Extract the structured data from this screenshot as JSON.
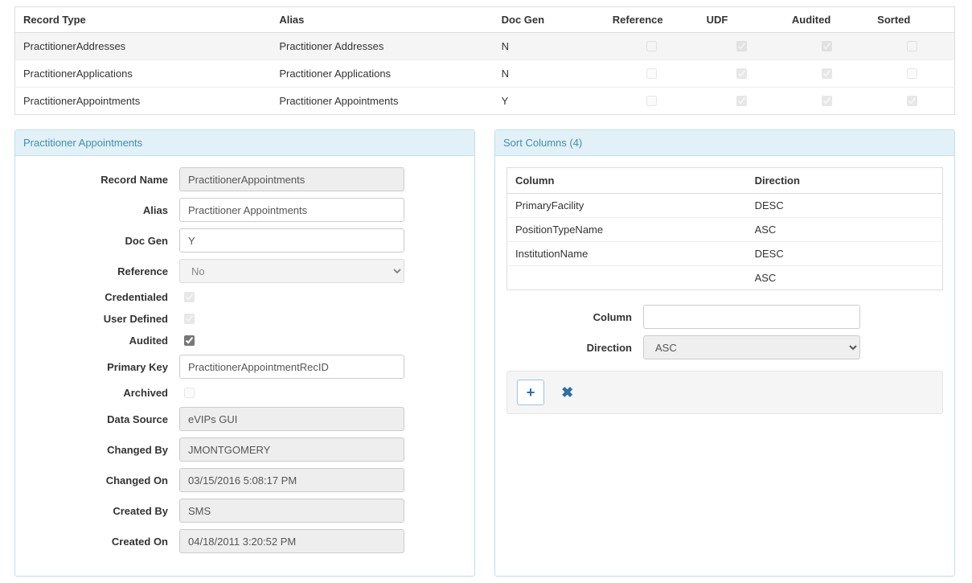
{
  "grid": {
    "headers": {
      "record_type": "Record Type",
      "alias": "Alias",
      "doc_gen": "Doc Gen",
      "reference": "Reference",
      "udf": "UDF",
      "audited": "Audited",
      "sorted": "Sorted"
    },
    "rows": [
      {
        "record_type": "PractitionerAddresses",
        "alias": "Practitioner Addresses",
        "doc_gen": "N",
        "reference": false,
        "udf": true,
        "audited": true,
        "sorted": false,
        "selected": true
      },
      {
        "record_type": "PractitionerApplications",
        "alias": "Practitioner Applications",
        "doc_gen": "N",
        "reference": false,
        "udf": true,
        "audited": true,
        "sorted": false,
        "selected": false
      },
      {
        "record_type": "PractitionerAppointments",
        "alias": "Practitioner Appointments",
        "doc_gen": "Y",
        "reference": false,
        "udf": true,
        "audited": true,
        "sorted": true,
        "selected": false
      }
    ]
  },
  "detail": {
    "title": "Practitioner Appointments",
    "labels": {
      "record_name": "Record Name",
      "alias": "Alias",
      "doc_gen": "Doc Gen",
      "reference": "Reference",
      "credentialed": "Credentialed",
      "user_defined": "User Defined",
      "audited": "Audited",
      "primary_key": "Primary Key",
      "archived": "Archived",
      "data_source": "Data Source",
      "changed_by": "Changed By",
      "changed_on": "Changed On",
      "created_by": "Created By",
      "created_on": "Created On"
    },
    "values": {
      "record_name": "PractitionerAppointments",
      "alias": "Practitioner Appointments",
      "doc_gen": "Y",
      "reference": "No",
      "credentialed": true,
      "user_defined": true,
      "audited": true,
      "primary_key": "PractitionerAppointmentRecID",
      "archived": false,
      "data_source": "eVIPs GUI",
      "changed_by": "JMONTGOMERY",
      "changed_on": "03/15/2016 5:08:17 PM",
      "created_by": "SMS",
      "created_on": "04/18/2011 3:20:52 PM"
    }
  },
  "sort": {
    "title": "Sort Columns (4)",
    "headers": {
      "column": "Column",
      "direction": "Direction"
    },
    "rows": [
      {
        "column": "PrimaryFacility",
        "direction": "DESC"
      },
      {
        "column": "PositionTypeName",
        "direction": "ASC"
      },
      {
        "column": "InstitutionName",
        "direction": "DESC"
      },
      {
        "column": "",
        "direction": "ASC"
      }
    ],
    "form": {
      "labels": {
        "column": "Column",
        "direction": "Direction"
      },
      "values": {
        "column": "",
        "direction": "ASC"
      }
    },
    "buttons": {
      "add": "+",
      "del": "✖"
    }
  }
}
